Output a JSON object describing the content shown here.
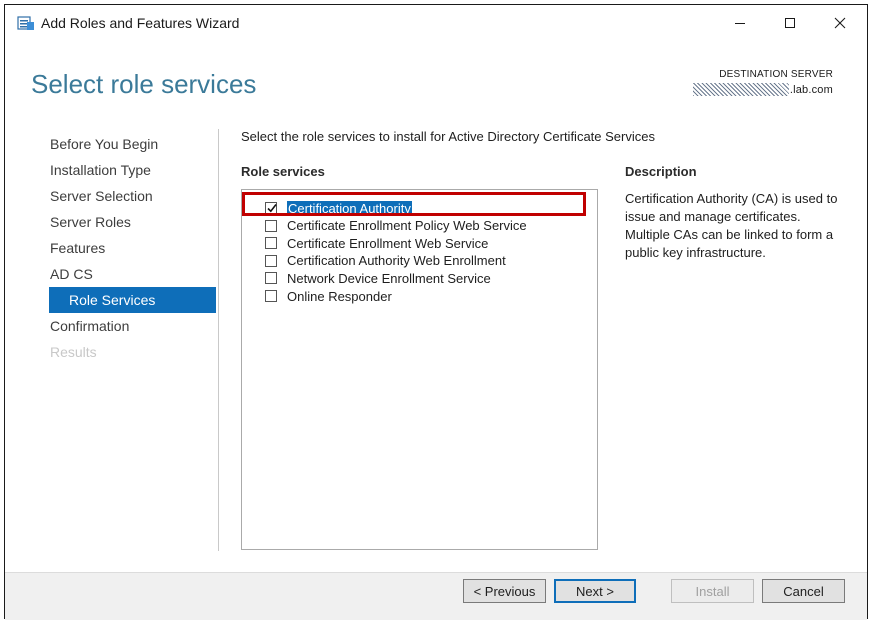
{
  "window": {
    "title": "Add Roles and Features Wizard",
    "minimize_icon": "minimize-icon",
    "maximize_icon": "maximize-icon",
    "close_icon": "close-icon"
  },
  "page": {
    "heading": "Select role services",
    "destination_label": "DESTINATION SERVER",
    "destination_server_suffix": ".lab.com"
  },
  "nav": {
    "items": [
      {
        "label": "Before You Begin",
        "state": "normal"
      },
      {
        "label": "Installation Type",
        "state": "normal"
      },
      {
        "label": "Server Selection",
        "state": "normal"
      },
      {
        "label": "Server Roles",
        "state": "normal"
      },
      {
        "label": "Features",
        "state": "normal"
      },
      {
        "label": "AD CS",
        "state": "normal"
      },
      {
        "label": "Role Services",
        "state": "active"
      },
      {
        "label": "Confirmation",
        "state": "normal"
      },
      {
        "label": "Results",
        "state": "disabled"
      }
    ]
  },
  "main": {
    "instruction": "Select the role services to install for Active Directory Certificate Services",
    "role_services_header": "Role services",
    "role_services": [
      {
        "label": "Certification Authority",
        "checked": true,
        "selected": true
      },
      {
        "label": "Certificate Enrollment Policy Web Service",
        "checked": false,
        "selected": false
      },
      {
        "label": "Certificate Enrollment Web Service",
        "checked": false,
        "selected": false
      },
      {
        "label": "Certification Authority Web Enrollment",
        "checked": false,
        "selected": false
      },
      {
        "label": "Network Device Enrollment Service",
        "checked": false,
        "selected": false
      },
      {
        "label": "Online Responder",
        "checked": false,
        "selected": false
      }
    ],
    "description_header": "Description",
    "description_text": "Certification Authority (CA) is used to issue and manage certificates. Multiple CAs can be linked to form a public key infrastructure."
  },
  "buttons": {
    "previous": "< Previous",
    "next": "Next >",
    "install": "Install",
    "cancel": "Cancel"
  },
  "colors": {
    "accent": "#0e6eb9",
    "heading": "#3b7a99",
    "highlight_box": "#c00000"
  }
}
